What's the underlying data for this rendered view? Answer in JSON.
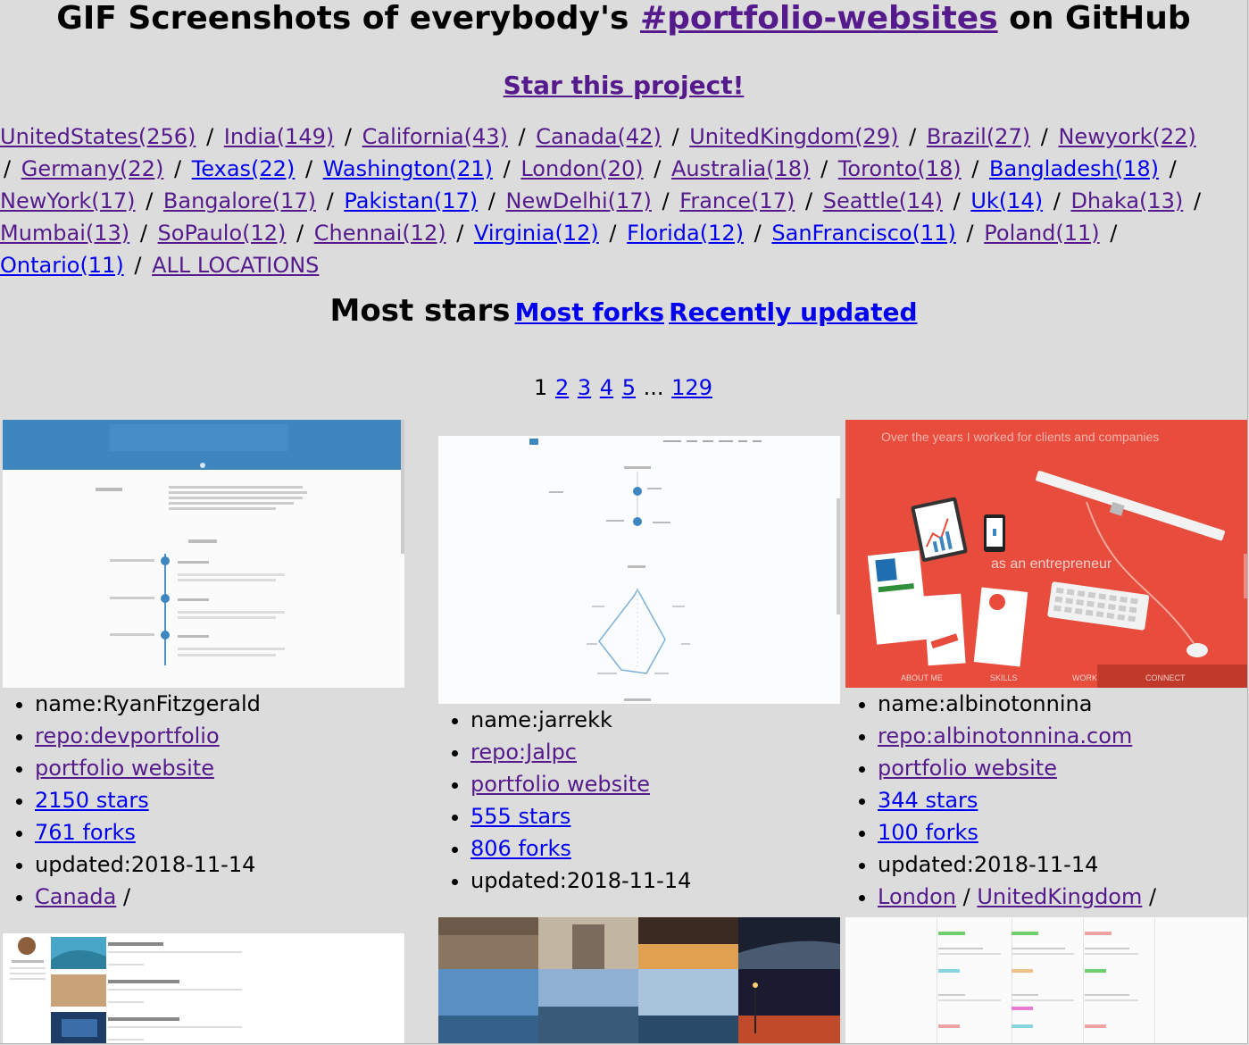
{
  "header": {
    "title_prefix": "GIF Screenshots of everybody's ",
    "title_link": "#portfolio-websites",
    "title_suffix": " on GitHub",
    "star_link": "Star this project!"
  },
  "locations": [
    {
      "label": "UnitedStates(256)",
      "visited": true
    },
    {
      "label": "India(149)",
      "visited": true
    },
    {
      "label": "California(43)",
      "visited": true
    },
    {
      "label": "Canada(42)",
      "visited": true
    },
    {
      "label": "UnitedKingdom(29)",
      "visited": true
    },
    {
      "label": "Brazil(27)",
      "visited": true
    },
    {
      "label": "Newyork(22)",
      "visited": true
    },
    {
      "label": "Germany(22)",
      "visited": true
    },
    {
      "label": "Texas(22)",
      "visited": false
    },
    {
      "label": "Washington(21)",
      "visited": false
    },
    {
      "label": "London(20)",
      "visited": true
    },
    {
      "label": "Australia(18)",
      "visited": true
    },
    {
      "label": "Toronto(18)",
      "visited": true
    },
    {
      "label": "Bangladesh(18)",
      "visited": false
    },
    {
      "label": "NewYork(17)",
      "visited": true
    },
    {
      "label": "Bangalore(17)",
      "visited": true
    },
    {
      "label": "Pakistan(17)",
      "visited": false
    },
    {
      "label": "NewDelhi(17)",
      "visited": true
    },
    {
      "label": "France(17)",
      "visited": true
    },
    {
      "label": "Seattle(14)",
      "visited": true
    },
    {
      "label": "Uk(14)",
      "visited": false
    },
    {
      "label": "Dhaka(13)",
      "visited": true
    },
    {
      "label": "Mumbai(13)",
      "visited": true
    },
    {
      "label": "SoPaulo(12)",
      "visited": true
    },
    {
      "label": "Chennai(12)",
      "visited": true
    },
    {
      "label": "Virginia(12)",
      "visited": false
    },
    {
      "label": "Florida(12)",
      "visited": false
    },
    {
      "label": "SanFrancisco(11)",
      "visited": false
    },
    {
      "label": "Poland(11)",
      "visited": true
    },
    {
      "label": "Ontario(11)",
      "visited": false
    },
    {
      "label": "ALL LOCATIONS",
      "visited": true
    }
  ],
  "separator": "/",
  "sort": {
    "current": "Most stars",
    "links": [
      "Most forks",
      "Recently updated"
    ]
  },
  "pagination": {
    "current": "1",
    "pages": [
      "2",
      "3",
      "4",
      "5"
    ],
    "ellipsis": "...",
    "last": "129"
  },
  "shot_texts": {
    "card3_headline": "Over the years I worked for clients and companies",
    "card3_sub": "as an entrepreneur",
    "card3_nav": [
      "ABOUT ME",
      "SKILLS",
      "WORK",
      "CONNECT"
    ]
  },
  "cards": [
    {
      "name": "name:RyanFitzgerald",
      "repo": "repo:devportfolio",
      "website": "portfolio website",
      "stars": "2150 stars",
      "forks": "761 forks",
      "updated": "updated:2018-11-14",
      "locations": [
        "Canada"
      ]
    },
    {
      "name": "name:jarrekk",
      "repo": "repo:Jalpc",
      "website": "portfolio website",
      "stars": "555 stars",
      "forks": "806 forks",
      "updated": "updated:2018-11-14",
      "locations": []
    },
    {
      "name": "name:albinotonnina",
      "repo": "repo:albinotonnina.com",
      "website": "portfolio website",
      "stars": "344 stars",
      "forks": "100 forks",
      "updated": "updated:2018-11-14",
      "locations": [
        "London",
        "UnitedKingdom"
      ]
    }
  ],
  "colors": {
    "background": "#dcdcdc",
    "link": "#0000ee",
    "visited": "#551a8b",
    "card3_red": "#e74c3c"
  }
}
